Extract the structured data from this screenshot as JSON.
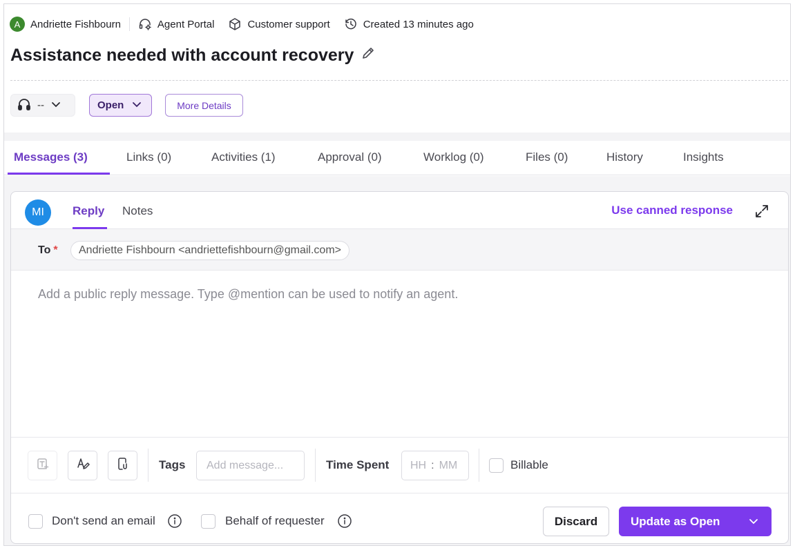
{
  "meta": {
    "requester_initial": "A",
    "requester_name": "Andriette Fishbourn",
    "portal": "Agent Portal",
    "group": "Customer support",
    "created": "Created 13 minutes ago"
  },
  "ticket": {
    "title": "Assistance needed with account recovery"
  },
  "controls": {
    "agent_value": "--",
    "status_value": "Open",
    "more_details_label": "More Details"
  },
  "tabs": [
    {
      "label": "Messages (3)",
      "active": true
    },
    {
      "label": "Links (0)"
    },
    {
      "label": "Activities (1)"
    },
    {
      "label": "Approval (0)"
    },
    {
      "label": "Worklog (0)"
    },
    {
      "label": "Files (0)"
    },
    {
      "label": "History"
    },
    {
      "label": "Insights"
    }
  ],
  "editor": {
    "agent_initials": "MI",
    "reply_tab": "Reply",
    "notes_tab": "Notes",
    "canned_response_label": "Use canned response",
    "to_label": "To",
    "required_mark": "*",
    "to_recipient": "Andriette Fishbourn <andriettefishbourn@gmail.com>",
    "message_placeholder": "Add a public reply message. Type @mention can be used to notify an agent.",
    "tags_label": "Tags",
    "tags_placeholder": "Add message...",
    "time_spent_label": "Time Spent",
    "time_hh_placeholder": "HH",
    "time_colon": ":",
    "time_mm_placeholder": "MM",
    "billable_label": "Billable",
    "dont_send_email_label": "Don't send an email",
    "behalf_label": "Behalf of requester",
    "discard_label": "Discard",
    "update_label": "Update as Open"
  },
  "colors": {
    "accent": "#7c3aed",
    "avatar_green": "#3c8a2e",
    "avatar_blue": "#1f8ce6",
    "required": "#e04646"
  }
}
